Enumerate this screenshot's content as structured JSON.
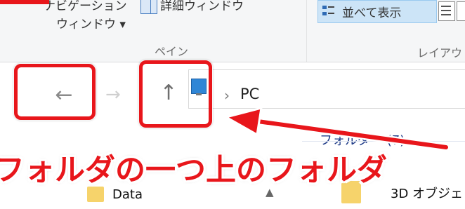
{
  "ribbon": {
    "nav_pane_line1": "ナビゲーション",
    "nav_pane_line2": "ウィンドウ ▾",
    "details_pane": "詳細ウィンドウ",
    "pane_group": "ペイン",
    "tiles_label": "並べて表示",
    "layout_group": "レイアウ"
  },
  "address_bar": {
    "location": "PC",
    "separator": "›"
  },
  "content": {
    "group_header": "フォルダー (7)",
    "items": [
      "Data",
      "3D オブジェ"
    ]
  },
  "annotation": {
    "callout": "フォルダの一つ上のフォルダ"
  },
  "colors": {
    "annotation_red": "#e8161b",
    "ribbon_bg": "#f5f6f7",
    "folder_yellow": "#f6d36b"
  }
}
